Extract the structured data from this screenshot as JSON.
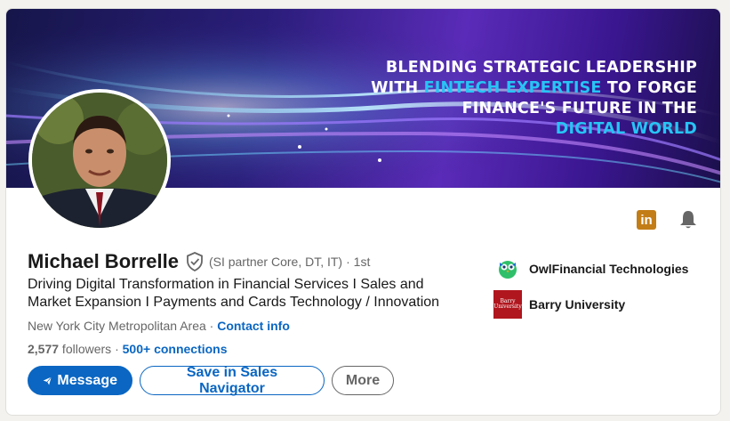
{
  "banner": {
    "line1": "BLENDING STRATEGIC LEADERSHIP",
    "line2_pre": "WITH ",
    "line2_hl": "FINTECH EXPERTISE",
    "line2_post": " TO FORGE",
    "line3": "FINANCE'S FUTURE IN THE",
    "line4": "DIGITAL WORLD"
  },
  "profile": {
    "name": "Michael Borrelle",
    "pronouns": "(SI partner Core, DT, IT)",
    "degree": "· 1st",
    "headline": "Driving Digital Transformation in Financial Services I Sales and Market Expansion I Payments and Cards Technology / Innovation",
    "location": "New York City Metropolitan Area",
    "location_sep": " · ",
    "contact_info": "Contact info",
    "followers_count": "2,577",
    "followers_label": " followers",
    "connections_sep": " · ",
    "connections": "500+ connections"
  },
  "actions": {
    "message": "Message",
    "save_sales_nav": "Save in Sales Navigator",
    "more": "More"
  },
  "side": {
    "company": "OwlFinancial Technologies",
    "school": "Barry University",
    "school_logo_text": "Barry University"
  },
  "icons": {
    "linkedin": "in",
    "bell": "bell-icon"
  },
  "colors": {
    "accent": "#0a66c2",
    "banner_highlight": "#27c4f5"
  }
}
